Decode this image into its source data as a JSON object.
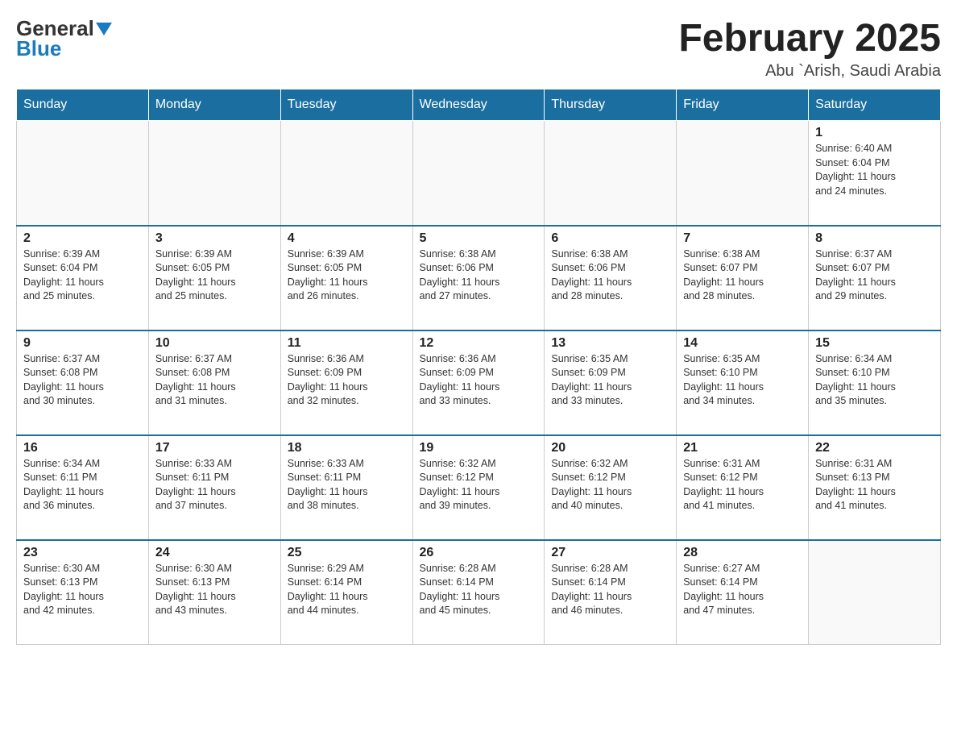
{
  "header": {
    "logo_general": "General",
    "logo_blue": "Blue",
    "title": "February 2025",
    "location": "Abu `Arish, Saudi Arabia"
  },
  "weekdays": [
    "Sunday",
    "Monday",
    "Tuesday",
    "Wednesday",
    "Thursday",
    "Friday",
    "Saturday"
  ],
  "weeks": [
    [
      {
        "day": "",
        "info": ""
      },
      {
        "day": "",
        "info": ""
      },
      {
        "day": "",
        "info": ""
      },
      {
        "day": "",
        "info": ""
      },
      {
        "day": "",
        "info": ""
      },
      {
        "day": "",
        "info": ""
      },
      {
        "day": "1",
        "info": "Sunrise: 6:40 AM\nSunset: 6:04 PM\nDaylight: 11 hours\nand 24 minutes."
      }
    ],
    [
      {
        "day": "2",
        "info": "Sunrise: 6:39 AM\nSunset: 6:04 PM\nDaylight: 11 hours\nand 25 minutes."
      },
      {
        "day": "3",
        "info": "Sunrise: 6:39 AM\nSunset: 6:05 PM\nDaylight: 11 hours\nand 25 minutes."
      },
      {
        "day": "4",
        "info": "Sunrise: 6:39 AM\nSunset: 6:05 PM\nDaylight: 11 hours\nand 26 minutes."
      },
      {
        "day": "5",
        "info": "Sunrise: 6:38 AM\nSunset: 6:06 PM\nDaylight: 11 hours\nand 27 minutes."
      },
      {
        "day": "6",
        "info": "Sunrise: 6:38 AM\nSunset: 6:06 PM\nDaylight: 11 hours\nand 28 minutes."
      },
      {
        "day": "7",
        "info": "Sunrise: 6:38 AM\nSunset: 6:07 PM\nDaylight: 11 hours\nand 28 minutes."
      },
      {
        "day": "8",
        "info": "Sunrise: 6:37 AM\nSunset: 6:07 PM\nDaylight: 11 hours\nand 29 minutes."
      }
    ],
    [
      {
        "day": "9",
        "info": "Sunrise: 6:37 AM\nSunset: 6:08 PM\nDaylight: 11 hours\nand 30 minutes."
      },
      {
        "day": "10",
        "info": "Sunrise: 6:37 AM\nSunset: 6:08 PM\nDaylight: 11 hours\nand 31 minutes."
      },
      {
        "day": "11",
        "info": "Sunrise: 6:36 AM\nSunset: 6:09 PM\nDaylight: 11 hours\nand 32 minutes."
      },
      {
        "day": "12",
        "info": "Sunrise: 6:36 AM\nSunset: 6:09 PM\nDaylight: 11 hours\nand 33 minutes."
      },
      {
        "day": "13",
        "info": "Sunrise: 6:35 AM\nSunset: 6:09 PM\nDaylight: 11 hours\nand 33 minutes."
      },
      {
        "day": "14",
        "info": "Sunrise: 6:35 AM\nSunset: 6:10 PM\nDaylight: 11 hours\nand 34 minutes."
      },
      {
        "day": "15",
        "info": "Sunrise: 6:34 AM\nSunset: 6:10 PM\nDaylight: 11 hours\nand 35 minutes."
      }
    ],
    [
      {
        "day": "16",
        "info": "Sunrise: 6:34 AM\nSunset: 6:11 PM\nDaylight: 11 hours\nand 36 minutes."
      },
      {
        "day": "17",
        "info": "Sunrise: 6:33 AM\nSunset: 6:11 PM\nDaylight: 11 hours\nand 37 minutes."
      },
      {
        "day": "18",
        "info": "Sunrise: 6:33 AM\nSunset: 6:11 PM\nDaylight: 11 hours\nand 38 minutes."
      },
      {
        "day": "19",
        "info": "Sunrise: 6:32 AM\nSunset: 6:12 PM\nDaylight: 11 hours\nand 39 minutes."
      },
      {
        "day": "20",
        "info": "Sunrise: 6:32 AM\nSunset: 6:12 PM\nDaylight: 11 hours\nand 40 minutes."
      },
      {
        "day": "21",
        "info": "Sunrise: 6:31 AM\nSunset: 6:12 PM\nDaylight: 11 hours\nand 41 minutes."
      },
      {
        "day": "22",
        "info": "Sunrise: 6:31 AM\nSunset: 6:13 PM\nDaylight: 11 hours\nand 41 minutes."
      }
    ],
    [
      {
        "day": "23",
        "info": "Sunrise: 6:30 AM\nSunset: 6:13 PM\nDaylight: 11 hours\nand 42 minutes."
      },
      {
        "day": "24",
        "info": "Sunrise: 6:30 AM\nSunset: 6:13 PM\nDaylight: 11 hours\nand 43 minutes."
      },
      {
        "day": "25",
        "info": "Sunrise: 6:29 AM\nSunset: 6:14 PM\nDaylight: 11 hours\nand 44 minutes."
      },
      {
        "day": "26",
        "info": "Sunrise: 6:28 AM\nSunset: 6:14 PM\nDaylight: 11 hours\nand 45 minutes."
      },
      {
        "day": "27",
        "info": "Sunrise: 6:28 AM\nSunset: 6:14 PM\nDaylight: 11 hours\nand 46 minutes."
      },
      {
        "day": "28",
        "info": "Sunrise: 6:27 AM\nSunset: 6:14 PM\nDaylight: 11 hours\nand 47 minutes."
      },
      {
        "day": "",
        "info": ""
      }
    ]
  ]
}
